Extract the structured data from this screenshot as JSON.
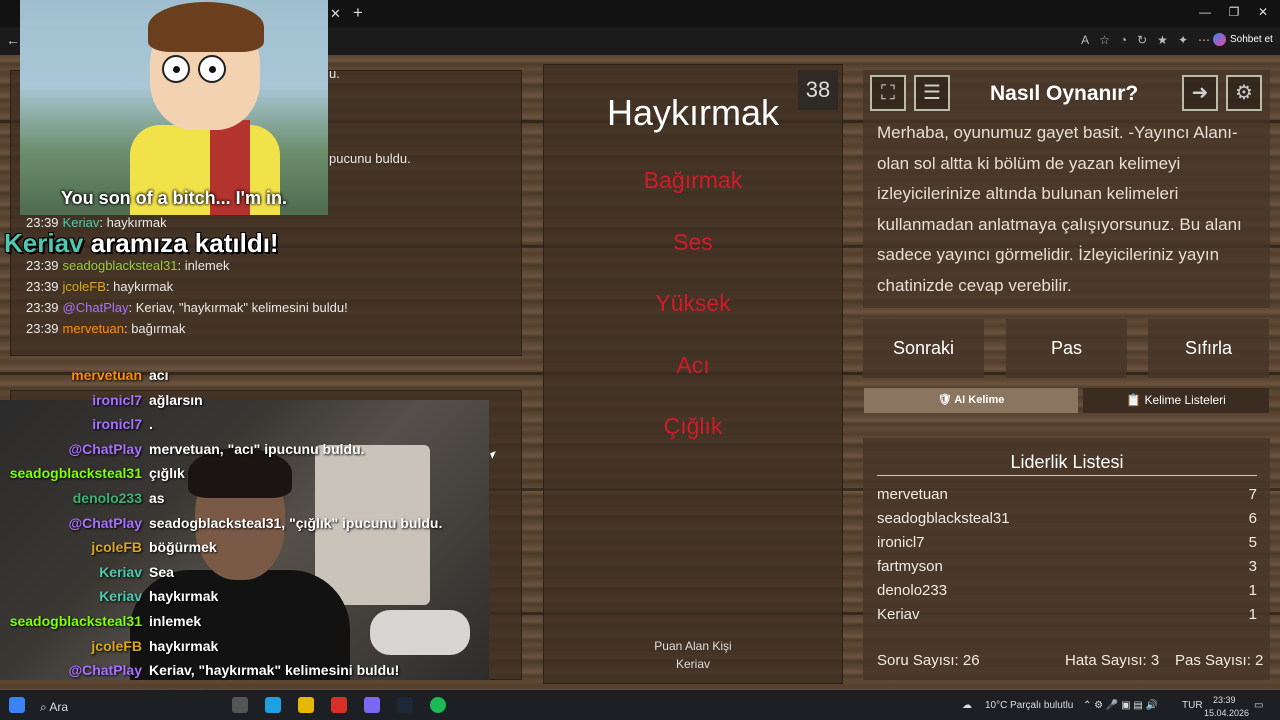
{
  "browser": {
    "sohbet_label": "Sohbet et"
  },
  "top_chat": [
    {
      "time": "23:39",
      "user": "Keriav",
      "user_color": "#4ec9b0",
      "msg": ": haykırmak"
    },
    {
      "time": "23:39",
      "user": "seadogblacksteal31",
      "user_color": "#9acd32",
      "msg": ": inlemek"
    },
    {
      "time": "23:39",
      "user": "jcoleFB",
      "user_color": "#daa520",
      "msg": ": haykırmak"
    },
    {
      "time": "23:39",
      "user": "@ChatPlay",
      "user_color": "#a970ff",
      "msg": ": Keriav, \"haykırmak\" kelimesini buldu!"
    },
    {
      "time": "23:39",
      "user": "mervetuan",
      "user_color": "#ff8c00",
      "msg": ": bağırmak"
    }
  ],
  "partial_text": {
    "line1": "u.",
    "line2": "pucunu buldu."
  },
  "meme": {
    "caption": "You son of a bitch... I'm in."
  },
  "join_alert": {
    "name": "Keriav",
    "text": " aramıza katıldı!"
  },
  "stream_chat": [
    {
      "user": "mervetuan",
      "color": "#ff8c00",
      "msg": "acı"
    },
    {
      "user": "ironicl7",
      "color": "#a970ff",
      "msg": "ağlarsın"
    },
    {
      "user": "ironicl7",
      "color": "#a970ff",
      "msg": "."
    },
    {
      "user": "@ChatPlay",
      "color": "#a970ff",
      "msg": "mervetuan, \"acı\" ipucunu buldu."
    },
    {
      "user": "seadogblacksteal31",
      "color": "#7fff00",
      "msg": "çığlık"
    },
    {
      "user": "denolo233",
      "color": "#3cb371",
      "msg": "as"
    },
    {
      "user": "@ChatPlay",
      "color": "#a970ff",
      "msg": "seadogblacksteal31, \"çığlık\" ipucunu buldu."
    },
    {
      "user": "jcoleFB",
      "color": "#daa520",
      "msg": "böğürmek"
    },
    {
      "user": "Keriav",
      "color": "#4ec9b0",
      "msg": "Sea"
    },
    {
      "user": "Keriav",
      "color": "#4ec9b0",
      "msg": "haykırmak"
    },
    {
      "user": "seadogblacksteal31",
      "color": "#7fff00",
      "msg": "inlemek"
    },
    {
      "user": "jcoleFB",
      "color": "#daa520",
      "msg": "haykırmak"
    },
    {
      "user": "@ChatPlay",
      "color": "#a970ff",
      "msg": "Keriav, \"haykırmak\" kelimesini buldu!"
    },
    {
      "user": "mervetuan",
      "color": "#ff8c00",
      "msg": "bağırmak"
    }
  ],
  "game": {
    "word": "Haykırmak",
    "timer": "38",
    "taboo_words": [
      "Bağırmak",
      "Ses",
      "Yüksek",
      "Acı",
      "Çığlık"
    ],
    "scorer_label": "Puan Alan Kişi",
    "scorer_name": "Keriav"
  },
  "howto": {
    "title": "Nasıl Oynanır?",
    "text": "Merhaba, oyunumuz gayet basit. -Yayıncı Alanı- olan sol altta ki bölüm de yazan kelimeyi izleyicilerinize altında bulunan kelimeleri kullanmadan anlatmaya çalışıyorsunuz. Bu alanı sadece yayıncı görmelidir. İzleyicileriniz yayın chatinizde cevap verebilir."
  },
  "actions": {
    "next": "Sonraki",
    "pass": "Pas",
    "reset": "Sıfırla",
    "ai_word": "AI Kelime",
    "word_lists": "Kelime Listeleri"
  },
  "leaderboard": {
    "title": "Liderlik Listesi",
    "rows": [
      {
        "name": "mervetuan",
        "score": "7"
      },
      {
        "name": "seadogblacksteal31",
        "score": "6"
      },
      {
        "name": "ironicl7",
        "score": "5"
      },
      {
        "name": "fartmyson",
        "score": "3"
      },
      {
        "name": "denolo233",
        "score": "1"
      },
      {
        "name": "Keriav",
        "score": "1"
      }
    ]
  },
  "stats": {
    "questions": "Soru Sayısı: 26",
    "errors": "Hata Sayısı: 3",
    "passes": "Pas Sayısı: 2"
  },
  "taskbar": {
    "search": "Ara",
    "weather": "10°C",
    "weather_desc": "Parçalı bulutlu",
    "lang": "TUR",
    "time": "23:39",
    "date": "15.04.2026"
  }
}
